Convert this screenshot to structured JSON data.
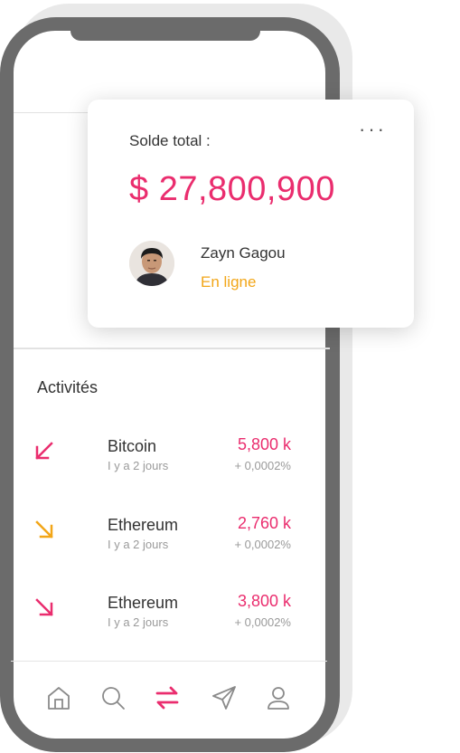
{
  "card": {
    "label": "Solde total :",
    "balance": "$ 27,800,900",
    "menu_glyph": "···",
    "user_name": "Zayn Gagou",
    "user_status": "En ligne"
  },
  "activities": {
    "title": "Activités",
    "items": [
      {
        "name": "Bitcoin",
        "date": "I y a 2 jours",
        "amount": "5,800 k",
        "change": "+ 0,0002%",
        "icon": "arrow-down-left-icon",
        "icon_color": "#ea2d6e"
      },
      {
        "name": "Ethereum",
        "date": "I y a 2 jours",
        "amount": "2,760 k",
        "change": "+ 0,0002%",
        "icon": "arrow-down-right-icon",
        "icon_color": "#f2a618"
      },
      {
        "name": "Ethereum",
        "date": "I y a 2 jours",
        "amount": "3,800 k",
        "change": "+ 0,0002%",
        "icon": "arrow-down-right-icon",
        "icon_color": "#ea2d6e"
      }
    ]
  },
  "nav": {
    "items": [
      "home-icon",
      "search-icon",
      "transfer-icon",
      "send-icon",
      "profile-icon"
    ],
    "active": "transfer-icon"
  },
  "colors": {
    "accent": "#ea2d6e",
    "status": "#f2a618",
    "icon": "#8a8a8a"
  }
}
